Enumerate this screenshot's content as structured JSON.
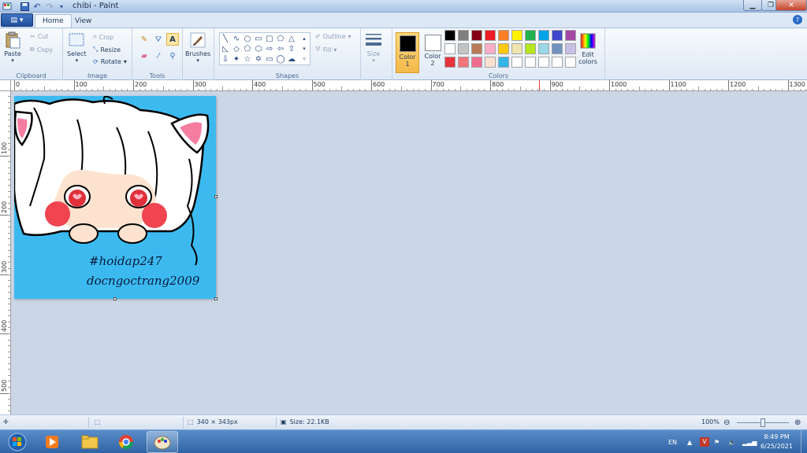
{
  "window": {
    "title": "chibi - Paint"
  },
  "tabs": [
    {
      "label": "Home"
    },
    {
      "label": "View"
    }
  ],
  "ribbon": {
    "clipboard": {
      "label": "Clipboard",
      "paste": "Paste",
      "cut": "Cut",
      "copy": "Copy"
    },
    "image": {
      "label": "Image",
      "select": "Select",
      "crop": "Crop",
      "resize": "Resize",
      "rotate": "Rotate"
    },
    "tools": {
      "label": "Tools"
    },
    "brushes": {
      "label": "Brushes"
    },
    "shapes": {
      "label": "Shapes",
      "outline": "Outline",
      "fill": "Fill"
    },
    "size": {
      "label": "Size"
    },
    "colors": {
      "label": "Colors",
      "color1": "Color\n1",
      "color1_line1": "Color",
      "color1_line2": "1",
      "color2_line1": "Color",
      "color2_line2": "2",
      "color1_value": "#000000",
      "color2_value": "#ffffff",
      "edit": "Edit",
      "edit2": "colors",
      "palette_row1": [
        "#000000",
        "#7f7f7f",
        "#880015",
        "#ed1c24",
        "#ff7f27",
        "#fff200",
        "#22b14c",
        "#00a2e8",
        "#3f48cc",
        "#a349a4"
      ],
      "palette_row2": [
        "#ffffff",
        "#c3c3c3",
        "#b97a57",
        "#ffaec9",
        "#ffc90e",
        "#efe4b0",
        "#b5e61d",
        "#99d9ea",
        "#7092be",
        "#c8bfe7"
      ],
      "palette_row3": [
        "#e8323c",
        "#f2767a",
        "#ef6d8f",
        "#fde0cf",
        "#34b5e8",
        "#ffffff",
        "#ffffff",
        "#ffffff",
        "#ffffff",
        "#ffffff"
      ]
    }
  },
  "ruler": {
    "h_labels": [
      "0",
      "100",
      "200",
      "300",
      "400",
      "500",
      "600",
      "700",
      "800",
      "900",
      "1000",
      "1100",
      "1200",
      "1300"
    ],
    "v_labels": [
      "100",
      "200",
      "300",
      "400",
      "500"
    ]
  },
  "canvas": {
    "watermark_line1": "#hoidap247",
    "watermark_line2": "docngoctrang2009"
  },
  "status": {
    "dimensions": "340 × 343px",
    "size": "Size: 22.1KB",
    "zoom": "100%"
  },
  "taskbar": {
    "lang": "EN",
    "time": "8:49 PM",
    "date": "6/25/2021"
  }
}
